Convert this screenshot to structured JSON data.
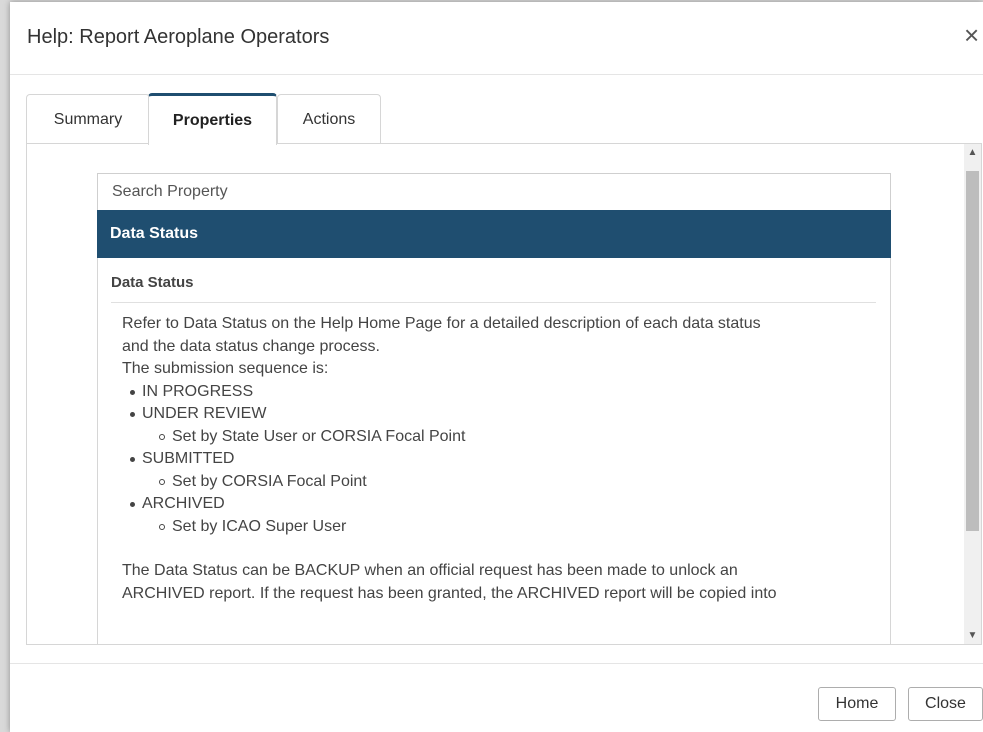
{
  "dialog": {
    "title": "Help: Report Aeroplane Operators",
    "close_glyph": "×"
  },
  "tabs": [
    {
      "label": "Summary",
      "active": false
    },
    {
      "label": "Properties",
      "active": true
    },
    {
      "label": "Actions",
      "active": false
    }
  ],
  "search": {
    "placeholder": "Search Property"
  },
  "section": {
    "title": "Data Status"
  },
  "property": {
    "heading": "Data Status",
    "intro_line1": "Refer to Data Status on the Help Home Page for a detailed description of each data status",
    "intro_line2": "and the data status change process.",
    "sequence_label": "The submission sequence is:",
    "statuses": [
      {
        "label": "IN PROGRESS",
        "sub": null
      },
      {
        "label": "UNDER REVIEW",
        "sub": "Set by State User or CORSIA Focal Point"
      },
      {
        "label": "SUBMITTED",
        "sub": "Set by CORSIA Focal Point"
      },
      {
        "label": "ARCHIVED",
        "sub": "Set by ICAO Super User"
      }
    ],
    "backup_line1": "The Data Status can be BACKUP when an official request has been made to unlock an",
    "backup_line2": "ARCHIVED report. If the request has been granted, the ARCHIVED report will be copied into"
  },
  "footer": {
    "home_label": "Home",
    "close_label": "Close"
  },
  "colors": {
    "accent": "#1f4e70",
    "background": "#ffffff",
    "border": "#d6d6d6"
  }
}
